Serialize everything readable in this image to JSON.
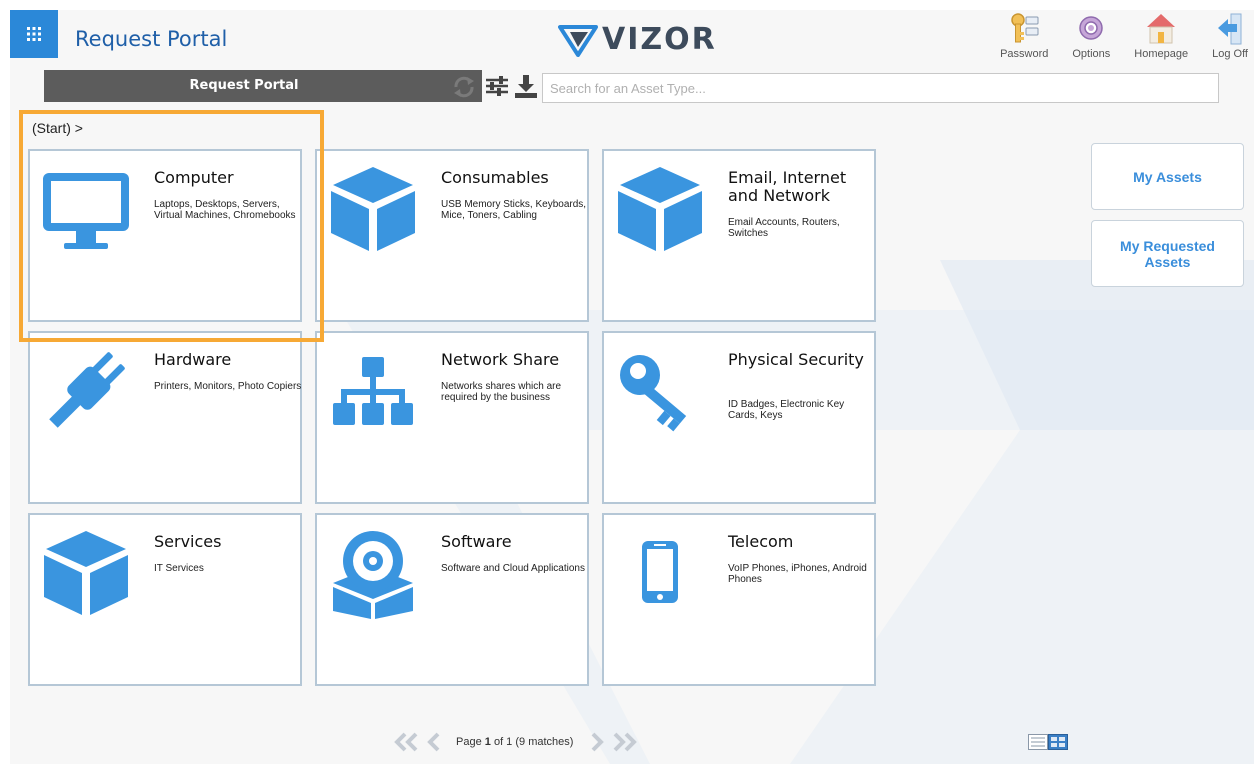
{
  "header": {
    "app_title": "Request Portal",
    "brand": "VIZOR",
    "actions": [
      {
        "label": "Password",
        "icon": "key-icon"
      },
      {
        "label": "Options",
        "icon": "gear-icon"
      },
      {
        "label": "Homepage",
        "icon": "home-icon"
      },
      {
        "label": "Log Off",
        "icon": "logoff-icon"
      }
    ]
  },
  "toolbar": {
    "label": "Request Portal",
    "search_placeholder": "Search for an Asset Type..."
  },
  "breadcrumb": "(Start) >",
  "tiles": [
    {
      "title": "Computer",
      "description": "Laptops, Desktops, Servers, Virtual Machines, Chromebooks",
      "icon": "monitor-icon"
    },
    {
      "title": "Consumables",
      "description": "USB Memory Sticks, Keyboards, Mice, Toners, Cabling",
      "icon": "cube-icon"
    },
    {
      "title": "Email, Internet and Network",
      "description": "Email Accounts, Routers, Switches",
      "icon": "cube-icon"
    },
    {
      "title": "Hardware",
      "description": "Printers, Monitors, Photo Copiers",
      "icon": "plug-icon"
    },
    {
      "title": "Network Share",
      "description": "Networks shares which are required by the business",
      "icon": "sitemap-icon"
    },
    {
      "title": "Physical Security",
      "description": "ID Badges, Electronic Key Cards, Keys",
      "icon": "key-icon"
    },
    {
      "title": "Services",
      "description": "IT Services",
      "icon": "cube-icon"
    },
    {
      "title": "Software",
      "description": "Software and Cloud Applications",
      "icon": "software-disc-icon"
    },
    {
      "title": "Telecom",
      "description": "VoIP Phones, iPhones, Android Phones",
      "icon": "phone-icon"
    }
  ],
  "side_buttons": [
    {
      "label": "My Assets"
    },
    {
      "label": "My Requested Assets"
    }
  ],
  "pager": {
    "prefix": "Page",
    "current": "1",
    "suffix": "of 1 (9 matches)"
  },
  "colors": {
    "accent": "#2b88d8",
    "icon_blue": "#3a95df",
    "highlight": "#f7a935",
    "title_blue": "#1f5fa8"
  }
}
